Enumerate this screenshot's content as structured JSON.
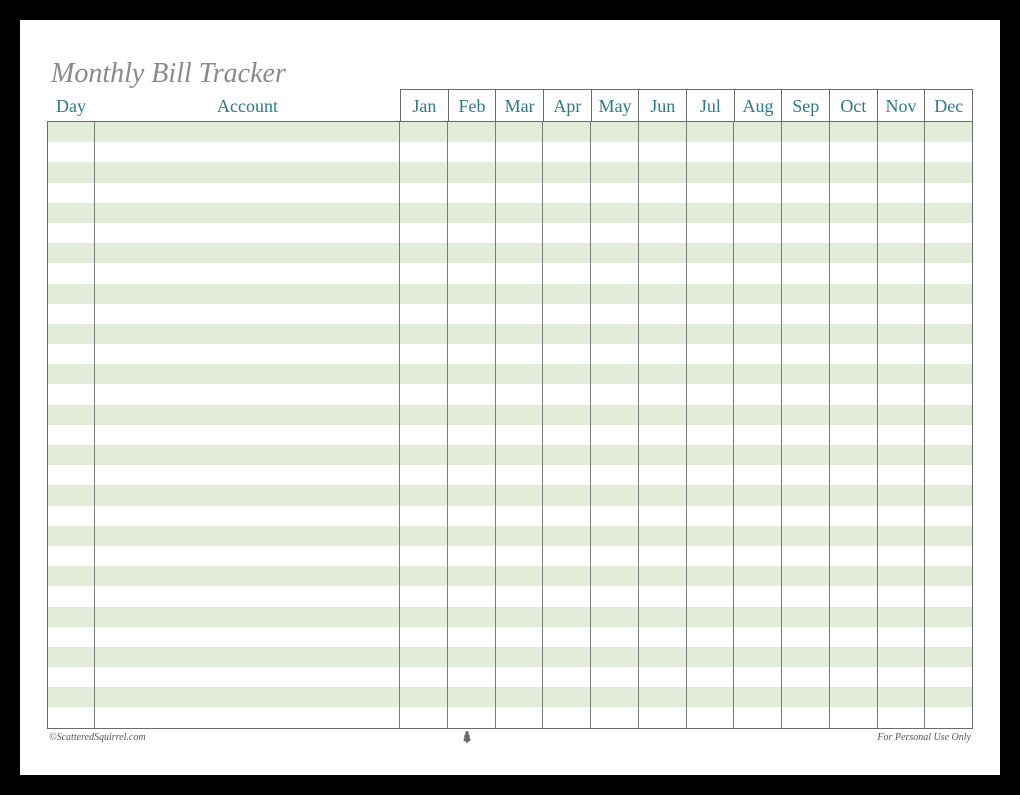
{
  "title": "Monthly Bill Tracker",
  "columns": {
    "day": "Day",
    "account": "Account"
  },
  "months": [
    "Jan",
    "Feb",
    "Mar",
    "Apr",
    "May",
    "Jun",
    "Jul",
    "Aug",
    "Sep",
    "Oct",
    "Nov",
    "Dec"
  ],
  "rows": 30,
  "footer": {
    "copyright": "©ScatteredSquirrel.com",
    "usage": "For Personal Use Only"
  }
}
